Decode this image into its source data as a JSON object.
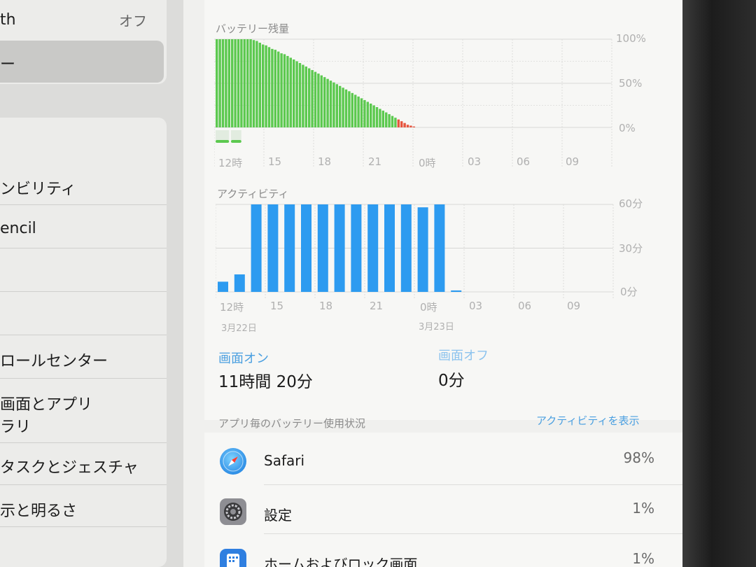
{
  "sidebar": {
    "bluetooth": {
      "label": "th",
      "value": "オフ"
    },
    "selected": {
      "label": "ー"
    },
    "items": [
      {
        "label": "ンビリティ"
      },
      {
        "label": "encil"
      },
      {
        "label": ""
      },
      {
        "label": ""
      },
      {
        "label": "ロールセンター"
      },
      {
        "label": "画面とアプリ"
      },
      {
        "label": "ラリ"
      },
      {
        "label": "タスクとジェスチャ"
      },
      {
        "label": "示と明るさ"
      }
    ]
  },
  "battery": {
    "section_label": "バッテリー残量",
    "y_labels": [
      "100%",
      "50%",
      "0%"
    ],
    "x_labels": [
      "12時",
      "15",
      "18",
      "21",
      "0時",
      "03",
      "06",
      "09"
    ]
  },
  "activity": {
    "section_label": "アクティビティ",
    "y_labels": [
      "60分",
      "30分",
      "0分"
    ],
    "x_labels": [
      "12時",
      "15",
      "18",
      "21",
      "0時",
      "03",
      "06",
      "09"
    ],
    "dates": [
      "3月22日",
      "3月23日"
    ]
  },
  "screen_on": {
    "label": "画面オン",
    "value": "11時間 20分"
  },
  "screen_off": {
    "label": "画面オフ",
    "value": "0分"
  },
  "app_usage": {
    "section_label": "アプリ毎のバッテリー使用状況",
    "show_activity_link": "アクティビティを表示",
    "apps": [
      {
        "name": "Safari",
        "percent": "98%",
        "icon": "safari-icon"
      },
      {
        "name": "設定",
        "percent": "1%",
        "icon": "settings-gear-icon"
      },
      {
        "name": "ホームおよびロック画面",
        "percent": "1%",
        "icon": "home-lock-screen-icon"
      }
    ]
  },
  "colors": {
    "battery_green": "#5cc94f",
    "battery_red": "#e6553f",
    "activity_blue": "#2d9bf0",
    "link_blue": "#4a9fe0"
  },
  "chart_data": [
    {
      "type": "bar",
      "title": "バッテリー残量",
      "x_range": [
        "12時",
        "09"
      ],
      "x_ticks": [
        "12時",
        "15",
        "18",
        "21",
        "0時",
        "03",
        "06",
        "09"
      ],
      "ylim": [
        0,
        100
      ],
      "y_ticks": [
        "100%",
        "50%",
        "0%"
      ],
      "grid": true,
      "series": [
        {
          "values": [
            100,
            100,
            100,
            100,
            100,
            100,
            100,
            100,
            100,
            100,
            100,
            100,
            99,
            98,
            96,
            94,
            93,
            91,
            89,
            88,
            86,
            84,
            83,
            81,
            79,
            77,
            75,
            73,
            71,
            69,
            67,
            65,
            63,
            61,
            59,
            57,
            55,
            53,
            51,
            49,
            47,
            45,
            43,
            41,
            39,
            37,
            35,
            33,
            31,
            29,
            27,
            25,
            23,
            21,
            19,
            17,
            15,
            13,
            11,
            9,
            7,
            5,
            3,
            2,
            1
          ]
        }
      ],
      "low_battery_threshold_percent": 10,
      "charging_indicator_segments": [
        [
          0,
          3
        ],
        [
          5,
          7
        ]
      ]
    },
    {
      "type": "bar",
      "title": "アクティビティ",
      "x_ticks": [
        "12時",
        "15",
        "18",
        "21",
        "0時",
        "03",
        "06",
        "09"
      ],
      "ylim": [
        0,
        60
      ],
      "y_ticks": [
        "60分",
        "30分",
        "0分"
      ],
      "grid": true,
      "series": [
        {
          "values": [
            7,
            12,
            60,
            60,
            60,
            60,
            60,
            60,
            60,
            60,
            60,
            60,
            58,
            60,
            1
          ]
        }
      ],
      "date_labels": [
        "3月22日",
        "3月23日"
      ]
    }
  ]
}
